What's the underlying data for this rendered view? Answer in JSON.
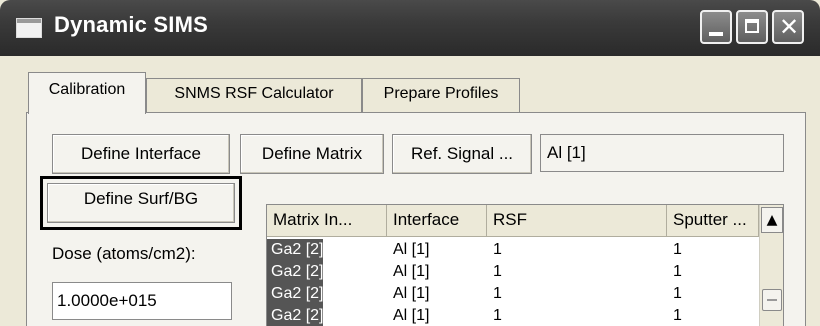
{
  "window": {
    "title": "Dynamic SIMS",
    "controls": {
      "minimize": "_",
      "maximize": "□",
      "close": "✕"
    }
  },
  "tabs": [
    {
      "label": "Calibration",
      "active": true
    },
    {
      "label": "SNMS RSF Calculator",
      "active": false
    },
    {
      "label": "Prepare Profiles",
      "active": false
    }
  ],
  "buttons": {
    "define_interface": "Define Interface",
    "define_matrix": "Define Matrix",
    "ref_signal": "Ref. Signal ...",
    "define_surf_bg": "Define Surf/BG"
  },
  "ref_signal_value": "Al [1]",
  "dose": {
    "label": "Dose (atoms/cm2):",
    "value": "1.0000e+015"
  },
  "table": {
    "columns": [
      "Matrix In...",
      "Interface",
      "RSF",
      "Sputter ..."
    ],
    "rows": [
      [
        "Ga2 [2]",
        "Al [1]",
        "1",
        "1"
      ],
      [
        "Ga2 [2]",
        "Al [1]",
        "1",
        "1"
      ],
      [
        "Ga2 [2]",
        "Al [1]",
        "1",
        "1"
      ],
      [
        "Ga2 [2]",
        "Al [1]",
        "1",
        "1"
      ]
    ],
    "scroll_up_icon": "▲"
  },
  "icons": {
    "app": "window-icon",
    "scroll_up": "chevron-up-icon"
  },
  "colors": {
    "titlebar": "#3a3a3a",
    "face": "#ece9d8",
    "selection": "#555555"
  }
}
